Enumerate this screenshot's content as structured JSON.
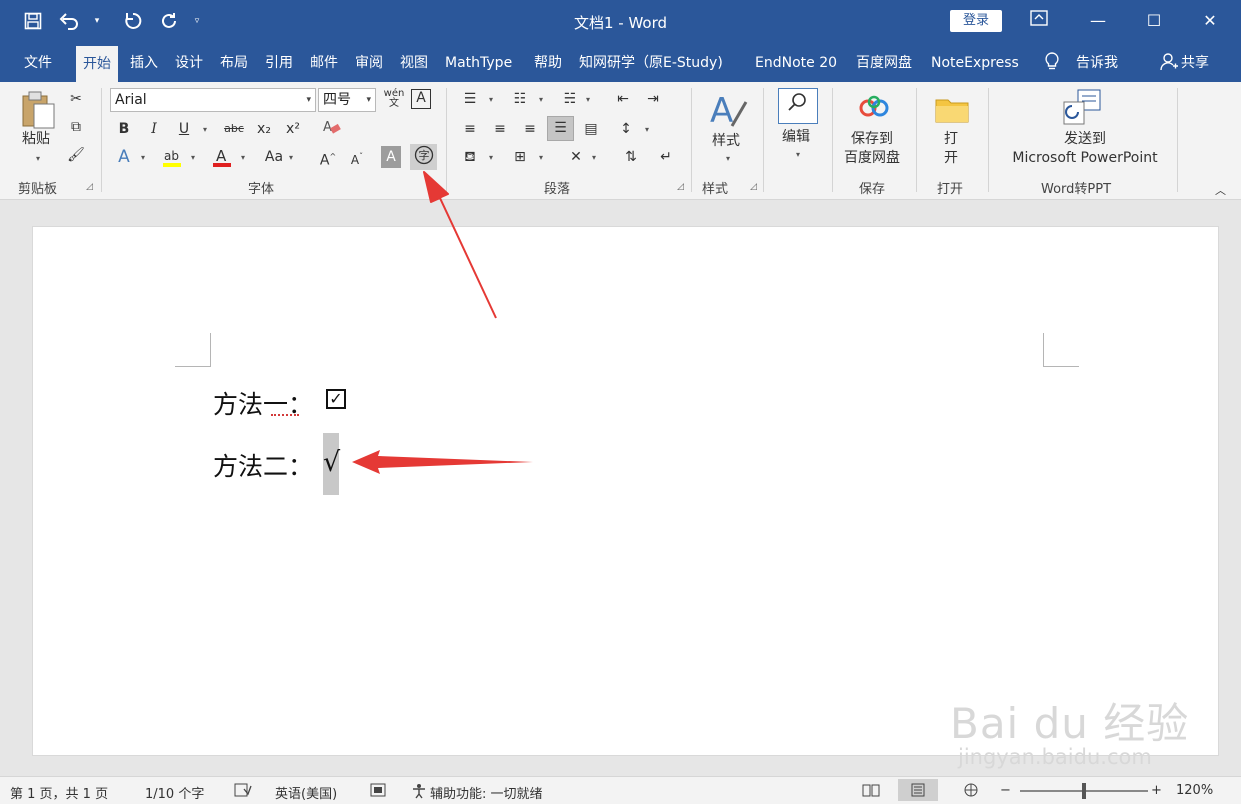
{
  "titlebar": {
    "title": "文档1  -  Word",
    "login_label": "登录",
    "accent_color": "#2b579a"
  },
  "tabs": [
    {
      "label": "文件"
    },
    {
      "label": "开始"
    },
    {
      "label": "插入"
    },
    {
      "label": "设计"
    },
    {
      "label": "布局"
    },
    {
      "label": "引用"
    },
    {
      "label": "邮件"
    },
    {
      "label": "审阅"
    },
    {
      "label": "视图"
    },
    {
      "label": "MathType"
    },
    {
      "label": "帮助"
    },
    {
      "label": "知网研学（原E-Study)"
    },
    {
      "label": "EndNote 20"
    },
    {
      "label": "百度网盘"
    },
    {
      "label": "NoteExpress"
    },
    {
      "label": "告诉我"
    },
    {
      "label": "共享"
    }
  ],
  "ribbon": {
    "clipboard": {
      "paste_label": "粘贴",
      "group_label": "剪贴板"
    },
    "font": {
      "font_name": "Arial",
      "font_size": "四号",
      "group_label": "字体",
      "bold": "B",
      "italic": "I",
      "underline": "U",
      "strike": "abc",
      "subscript": "x₂",
      "superscript": "x²",
      "change_case": "Aa",
      "grow": "A",
      "shrink": "A",
      "phonetic": "wén\n文",
      "border_char": "A",
      "shade_char": "A",
      "enclose_char": "字"
    },
    "paragraph": {
      "group_label": "段落"
    },
    "styles": {
      "label": "样式",
      "group_label": "样式"
    },
    "editing": {
      "label": "编辑"
    },
    "save": {
      "label1": "保存到",
      "label2": "百度网盘",
      "group_label": "保存"
    },
    "open": {
      "label1": "打",
      "label2": "开",
      "group_label": "打开"
    },
    "ppt": {
      "label1": "发送到",
      "label2": "Microsoft PowerPoint",
      "group_label": "Word转PPT"
    }
  },
  "document": {
    "line1_label": "方法一：",
    "line1_symbol": "☑",
    "line2_label": "方法二：",
    "line2_symbol": "√"
  },
  "watermark": {
    "main": "Bai du 经验",
    "sub": "jingyan.baidu.com"
  },
  "statusbar": {
    "page": "第 1 页，共 1 页",
    "words": "1/10 个字",
    "language": "英语(美国)",
    "accessibility": "辅助功能: 一切就绪",
    "zoom": "120%"
  }
}
